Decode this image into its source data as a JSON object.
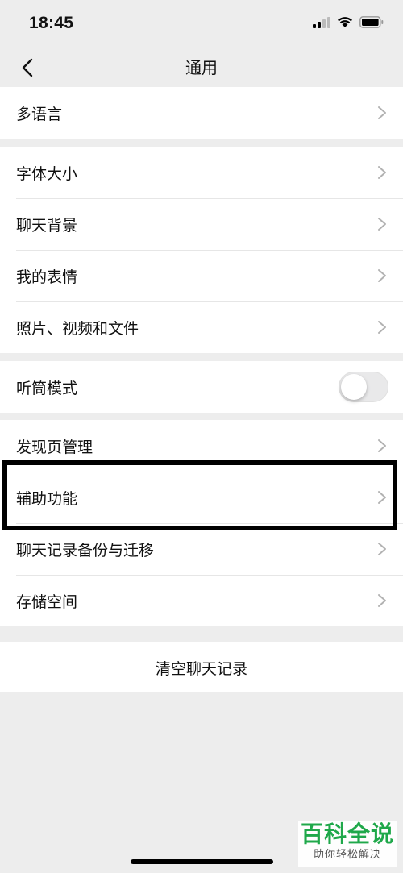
{
  "status_bar": {
    "time": "18:45"
  },
  "nav": {
    "title": "通用"
  },
  "groups": [
    {
      "items": [
        {
          "label": "多语言"
        }
      ]
    },
    {
      "items": [
        {
          "label": "字体大小"
        },
        {
          "label": "聊天背景"
        },
        {
          "label": "我的表情"
        },
        {
          "label": "照片、视频和文件"
        }
      ]
    },
    {
      "items": [
        {
          "label": "听筒模式",
          "toggle": false
        }
      ]
    },
    {
      "items": [
        {
          "label": "发现页管理"
        },
        {
          "label": "辅助功能"
        },
        {
          "label": "聊天记录备份与迁移"
        },
        {
          "label": "存储空间"
        }
      ]
    }
  ],
  "clear_button": {
    "label": "清空聊天记录"
  },
  "watermark": {
    "title": "百科全说",
    "subtitle": "助你轻松解决"
  },
  "colors": {
    "background": "#ededed",
    "card": "#ffffff",
    "watermark_green": "#1fa84a",
    "highlight": "#000000"
  }
}
